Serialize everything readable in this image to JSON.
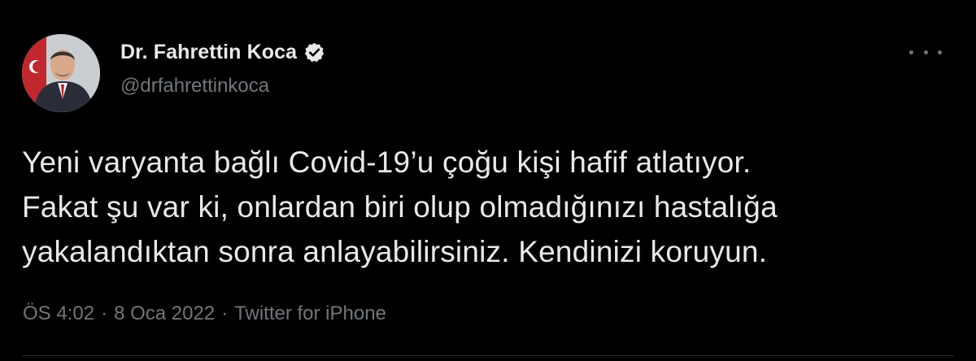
{
  "tweet": {
    "author": {
      "display_name": "Dr. Fahrettin Koca",
      "handle": "@drfahrettinkoca",
      "verified": true
    },
    "text_lines": [
      "Yeni varyanta bağlı Covid-19’u çoğu kişi hafif atlatıyor.",
      "Fakat şu var ki, onlardan biri olup olmadığınızı hastalığa",
      "yakalandıktan sonra anlayabilirsiniz. Kendinizi koruyun."
    ],
    "time": "ÖS 4:02",
    "separator": "·",
    "date": "8 Oca 2022",
    "source": "Twitter for iPhone"
  },
  "icons": {
    "verified": "verified-badge-icon",
    "more": "more-options-icon"
  },
  "colors": {
    "background": "#000000",
    "primary_text": "#e7e9ea",
    "secondary_text": "#71767b",
    "divider": "#2f3336"
  }
}
